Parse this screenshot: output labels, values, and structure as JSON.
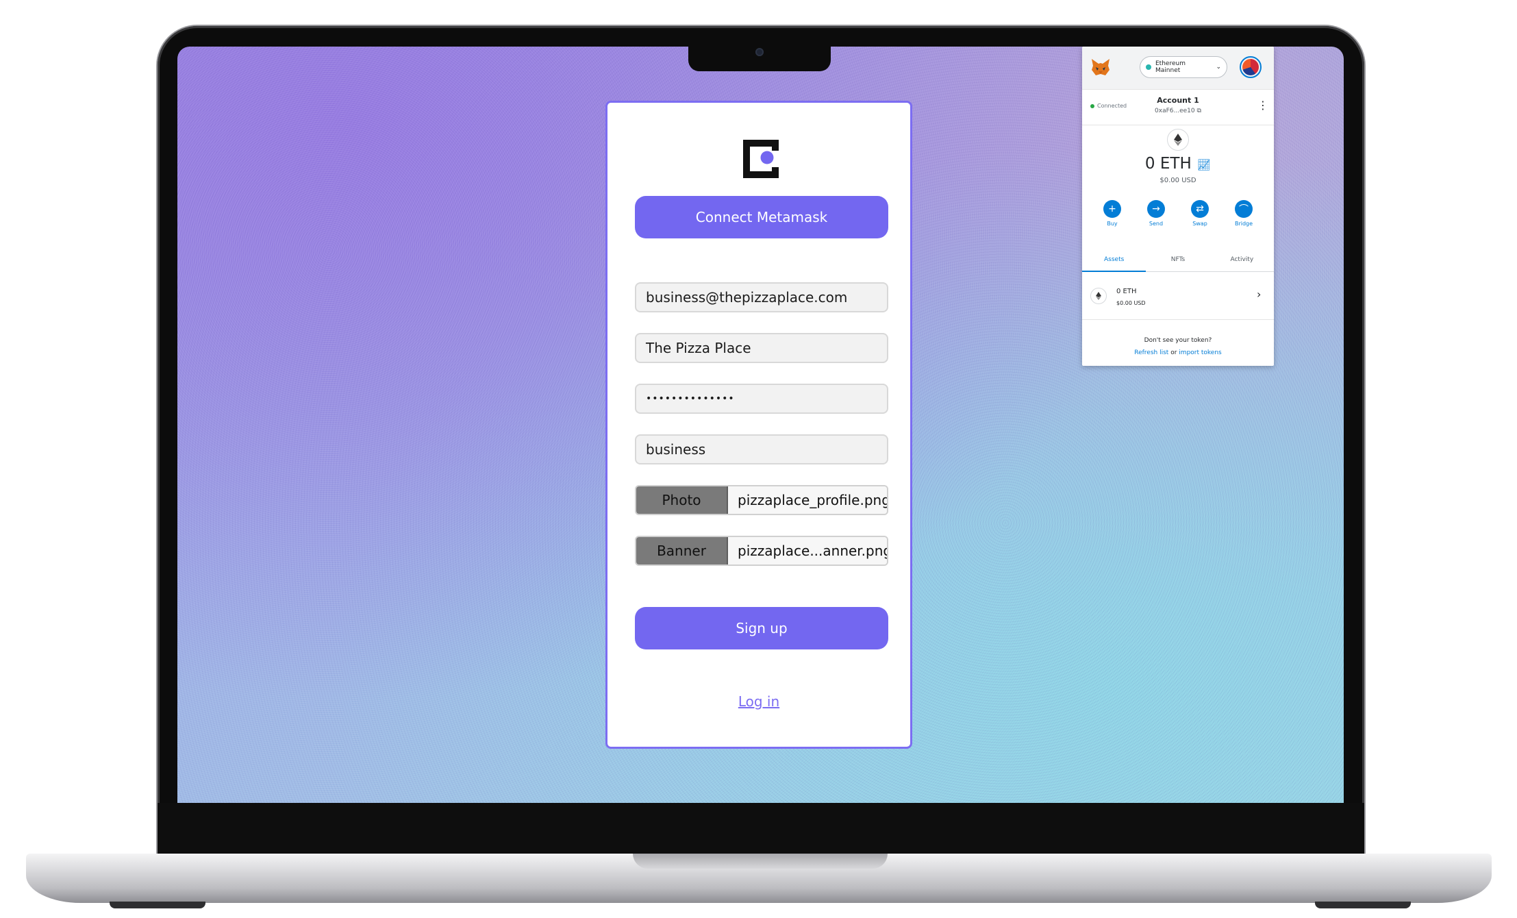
{
  "signup": {
    "connect_button": "Connect Metamask",
    "email": "business@thepizzaplace.com",
    "name": "The Pizza Place",
    "password_mask": "••••••••••••••",
    "role": "business",
    "photo": {
      "button": "Photo",
      "filename": "pizzaplace_profile.png"
    },
    "banner": {
      "button": "Banner",
      "filename": "pizzaplace...anner.png"
    },
    "signup_button": "Sign up",
    "login_link": "Log in",
    "accent_color": "#7367f0"
  },
  "metamask": {
    "network": "Ethereum Mainnet",
    "connection_status": "Connected",
    "account_name": "Account 1",
    "account_address": "0xaF6...ee10",
    "balance": "0 ETH",
    "balance_usd": "$0.00 USD",
    "actions": [
      {
        "label": "Buy",
        "icon": "plus-icon"
      },
      {
        "label": "Send",
        "icon": "arrow-right-icon"
      },
      {
        "label": "Swap",
        "icon": "swap-icon"
      },
      {
        "label": "Bridge",
        "icon": "bridge-icon"
      }
    ],
    "tabs": [
      "Assets",
      "NFTs",
      "Activity"
    ],
    "active_tab": "Assets",
    "asset": {
      "amount": "0 ETH",
      "usd": "$0.00 USD"
    },
    "token_prompt": "Don't see your token?",
    "refresh_link": "Refresh list",
    "or_text": "or",
    "import_link": "import tokens",
    "accent_color": "#037dd6"
  }
}
